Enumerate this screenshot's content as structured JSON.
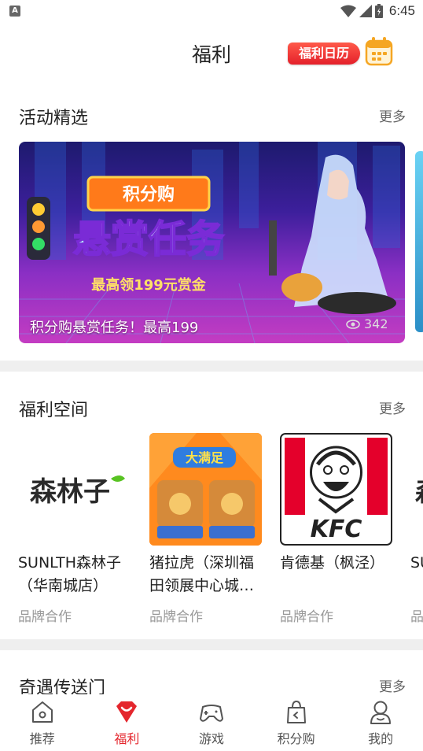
{
  "status_bar": {
    "notification_letter": "A",
    "time": "6:45"
  },
  "header": {
    "title": "福利",
    "calendar_badge": "福利日历"
  },
  "activity_section": {
    "title": "活动精选",
    "more": "更多",
    "banner": {
      "tag_text": "积分购",
      "headline": "悬赏任务",
      "subline": "最高领199元赏金",
      "caption": "积分购悬赏任务！最高199",
      "views": "342"
    }
  },
  "welfare_section": {
    "title": "福利空间",
    "more": "更多",
    "cards": [
      {
        "name": "SUNLTH森林子（华南城店）",
        "logo_text": "森林子",
        "tag": "品牌合作"
      },
      {
        "name": "猪拉虎（深圳福田领展中心城…",
        "logo_text": "大满足",
        "tag": "品牌合作"
      },
      {
        "name": "肯德基（枫泾）",
        "logo_text": "KFC",
        "tag": "品牌合作"
      },
      {
        "name": "SU(",
        "tag": "品"
      }
    ]
  },
  "portal_section": {
    "title": "奇遇传送门",
    "more": "更多"
  },
  "bottom_nav": {
    "items": [
      {
        "label": "推荐",
        "icon": "home-icon"
      },
      {
        "label": "福利",
        "icon": "gift-heart-icon",
        "active": true
      },
      {
        "label": "游戏",
        "icon": "gamepad-icon"
      },
      {
        "label": "积分购",
        "icon": "shopping-bag-icon"
      },
      {
        "label": "我的",
        "icon": "user-icon"
      }
    ]
  },
  "colors": {
    "accent": "#e4262d",
    "divider": "#efefef",
    "muted_text": "#999999"
  }
}
